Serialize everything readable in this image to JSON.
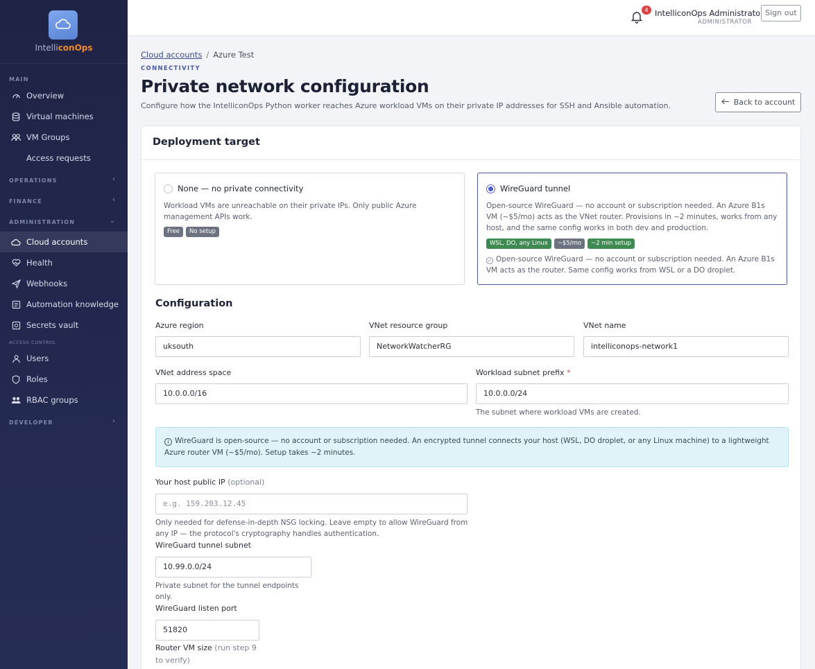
{
  "brand": {
    "name_part1": "Intelli",
    "name_part2": "conOps"
  },
  "sidebar": {
    "main_label": "MAIN",
    "operations_label": "OPERATIONS",
    "finance_label": "FINANCE",
    "administration_label": "ADMINISTRATION",
    "access_control_label": "ACCESS CONTROL",
    "developer_label": "DEVELOPER",
    "main_items": [
      {
        "label": "Overview",
        "icon": "dashboard-icon"
      },
      {
        "label": "Virtual machines",
        "icon": "database-icon"
      },
      {
        "label": "VM Groups",
        "icon": "group-icon"
      },
      {
        "label": "Access requests"
      }
    ],
    "admin_items": [
      {
        "label": "Cloud accounts",
        "icon": "cloud-icon",
        "active": true
      },
      {
        "label": "Health",
        "icon": "heart-icon"
      },
      {
        "label": "Webhooks",
        "icon": "send-icon"
      },
      {
        "label": "Automation knowledge",
        "icon": "book-icon"
      },
      {
        "label": "Secrets vault",
        "icon": "vault-icon"
      }
    ],
    "access_items": [
      {
        "label": "Users",
        "icon": "user-icon"
      },
      {
        "label": "Roles",
        "icon": "shield-icon"
      },
      {
        "label": "RBAC groups",
        "icon": "users-icon"
      }
    ]
  },
  "topbar": {
    "notification_count": "4",
    "user_name": "IntelliconOps Administrator",
    "user_role": "ADMINISTRATOR",
    "signout_label": "Sign out"
  },
  "breadcrumb": {
    "parent": "Cloud accounts",
    "separator": "/",
    "current": "Azure Test"
  },
  "header": {
    "eyebrow": "CONNECTIVITY",
    "title": "Private network configuration",
    "subtitle": "Configure how the IntelliconOps Python worker reaches Azure workload VMs on their private IP addresses for SSH and Ansible automation.",
    "back_label": "Back to account"
  },
  "deployment": {
    "title": "Deployment target",
    "options": [
      {
        "title": "None — no private connectivity",
        "description": "Workload VMs are unreachable on their private IPs. Only public Azure management APIs work.",
        "tags": [
          "Free",
          "No setup"
        ],
        "selected": false
      },
      {
        "title": "WireGuard tunnel",
        "description": "Open-source WireGuard — no account or subscription needed. An Azure B1s VM (~$5/mo) acts as the VNet router. Provisions in ~2 minutes, works from any host, and the same config works in both dev and production.",
        "tags": [
          "WSL, DO, any Linux",
          "~$5/mo",
          "~2 min setup"
        ],
        "note": "Open-source WireGuard — no account or subscription needed. An Azure B1s VM acts as the router. Same config works from WSL or a DO droplet.",
        "selected": true
      }
    ]
  },
  "configuration": {
    "title": "Configuration",
    "azure_region": {
      "label": "Azure region",
      "value": "uksouth"
    },
    "vnet_rg": {
      "label": "VNet resource group",
      "value": "NetworkWatcherRG"
    },
    "vnet_name": {
      "label": "VNet name",
      "value": "intelliconops-network1"
    },
    "vnet_space": {
      "label": "VNet address space",
      "value": "10.0.0.0/16"
    },
    "subnet_prefix": {
      "label": "Workload subnet prefix",
      "required": "*",
      "value": "10.0.0.0/24",
      "help": "The subnet where workload VMs are created."
    },
    "info": "WireGuard is open-source — no account or subscription needed. An encrypted tunnel connects your host (WSL, DO droplet, or any Linux machine) to a lightweight Azure router VM (~$5/mo). Setup takes ~2 minutes.",
    "host_ip": {
      "label": "Your host public IP",
      "label_note": "(optional)",
      "placeholder": "e.g. 159.203.12.45",
      "help": "Only needed for defense-in-depth NSG locking. Leave empty to allow WireGuard from any IP — the protocol's cryptography handles authentication."
    },
    "tunnel_subnet": {
      "label": "WireGuard tunnel subnet",
      "value": "10.99.0.0/24",
      "help": "Private subnet for the tunnel endpoints only."
    },
    "listen_port": {
      "label": "WireGuard listen port",
      "value": "51820"
    },
    "router_size": {
      "label": "Router VM size",
      "label_note": "(run step 9 to verify)"
    }
  }
}
